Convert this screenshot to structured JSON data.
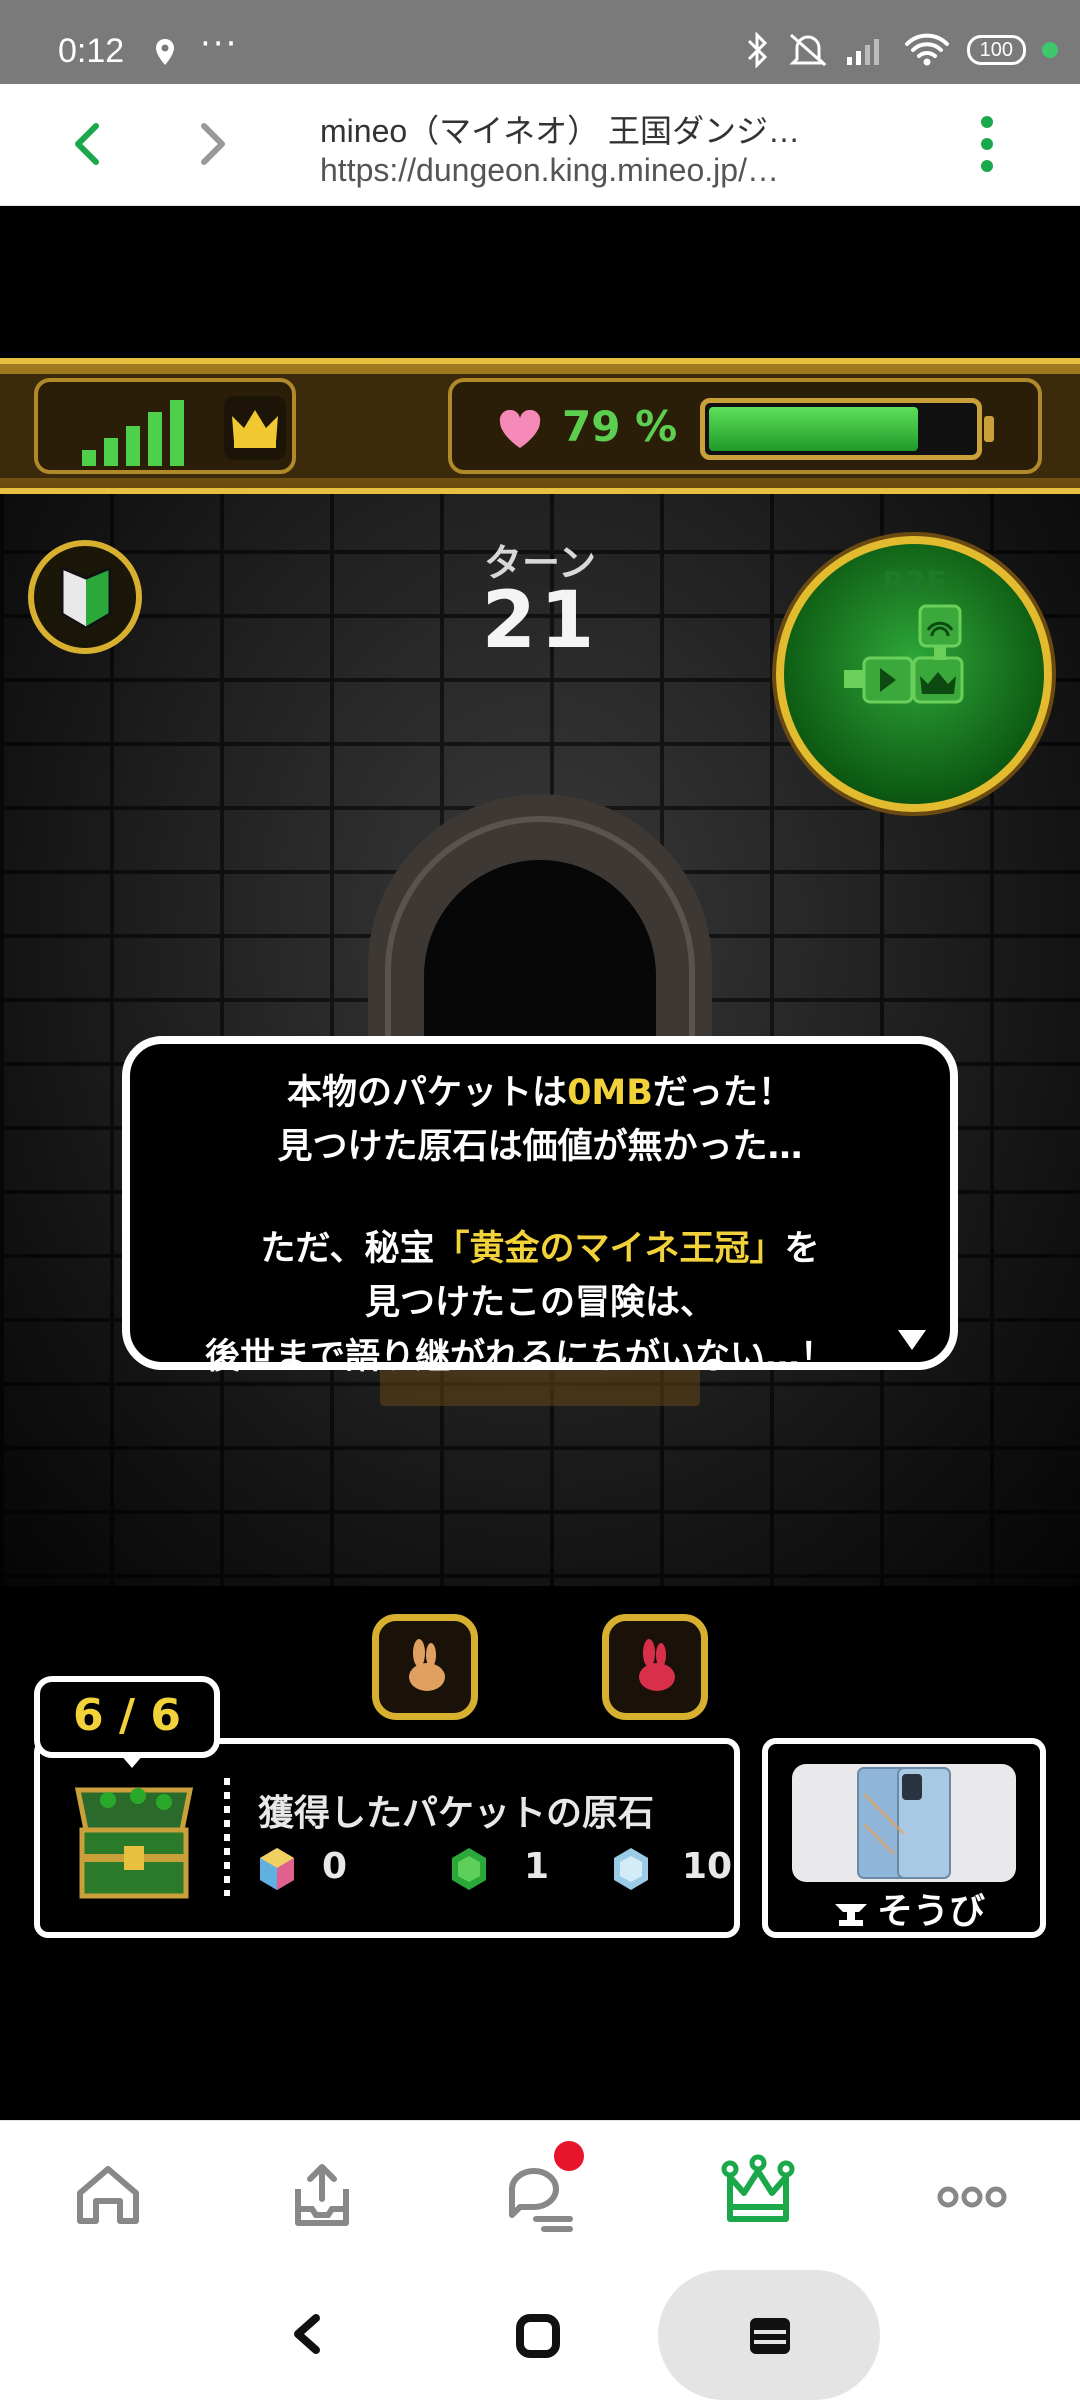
{
  "status_bar": {
    "time": "0:12",
    "dots": "···",
    "battery": "100"
  },
  "browser": {
    "title": "mineo（マイネオ） 王国ダンジ…",
    "url": "https://dungeon.king.mineo.jp/…"
  },
  "hud": {
    "life_percent_label": "79 %",
    "life_fraction": 0.79,
    "signal_bars": 5
  },
  "turn": {
    "label": "ターン",
    "number": "21"
  },
  "minimap": {
    "floor": "B2F"
  },
  "dialog": {
    "line1_pre": "本物のパケットは",
    "line1_hl": "0MB",
    "line1_post": "だった！",
    "line2": "見つけた原石は価値が無かった…",
    "line3_pre": "ただ、秘宝",
    "line3_hl": "「黄金のマイネ王冠」",
    "line3_post": "を",
    "line4": "見つけたこの冒険は、",
    "line5": "後世まで語り継がれるにちがいない…！"
  },
  "loot": {
    "counter": "6 / 6",
    "title": "獲得したパケットの原石",
    "gems": [
      {
        "name": "rainbow-gem",
        "count": "0"
      },
      {
        "name": "green-gem",
        "count": "1"
      },
      {
        "name": "blue-gem",
        "count": "10"
      }
    ]
  },
  "equip": {
    "label": "そうび"
  },
  "colors": {
    "accent_green": "#1aa84a",
    "gold": "#d8b030",
    "highlight_yellow": "#f2d23a",
    "notification_red": "#e8142a"
  }
}
